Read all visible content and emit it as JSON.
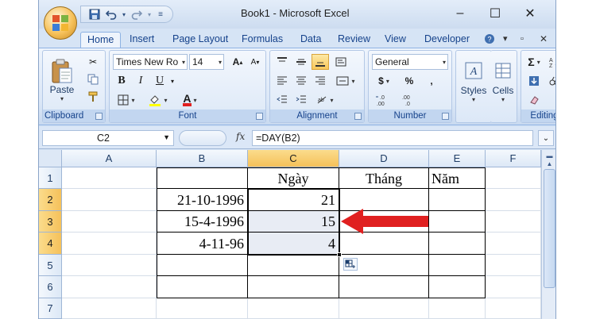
{
  "window": {
    "title": "Book1 - Microsoft Excel",
    "minimize": "–",
    "maximize": "☐",
    "close": "✕"
  },
  "qat": {
    "save_icon": "save-icon",
    "undo_icon": "undo-icon",
    "redo_icon": "redo-icon",
    "customize_icon": "customize-icon"
  },
  "tabs": [
    "Home",
    "Insert",
    "Page Layout",
    "Formulas",
    "Data",
    "Review",
    "View",
    "Developer"
  ],
  "active_tab": "Home",
  "ribbon": {
    "clipboard": {
      "label": "Clipboard",
      "paste": "Paste"
    },
    "font": {
      "label": "Font",
      "font_name": "Times New Ro",
      "font_size": "14",
      "bold": "B",
      "italic": "I",
      "underline": "U",
      "grow": "A˄",
      "shrink": "A˅"
    },
    "alignment": {
      "label": "Alignment"
    },
    "number": {
      "label": "Number",
      "format": "General",
      "currency": "$",
      "percent": "%",
      "comma": ",",
      "inc_dec": "←.0\n.00",
      "dec_dec": ".00\n→.0"
    },
    "styles": {
      "label": "Styles"
    },
    "cells": {
      "label": "Cells"
    },
    "editing": {
      "label": "Editing",
      "sum": "Σ"
    }
  },
  "formula_bar": {
    "name_box": "C2",
    "fx": "fx",
    "formula": "=DAY(B2)"
  },
  "sheet": {
    "columns": [
      "A",
      "B",
      "C",
      "D",
      "E",
      "F"
    ],
    "rows": [
      "1",
      "2",
      "3",
      "4",
      "5",
      "6",
      "7"
    ],
    "cells": {
      "C1": "Ngày",
      "D1": "Tháng",
      "E1": "Năm",
      "B2": "21-10-1996",
      "C2": "21",
      "B3": "15-4-1996",
      "C3": "15",
      "B4": "4-11-96",
      "C4": "4"
    },
    "selected_range": "C2:C4",
    "selection_color": "#e8ecf4",
    "arrow_color": "#e02020"
  }
}
